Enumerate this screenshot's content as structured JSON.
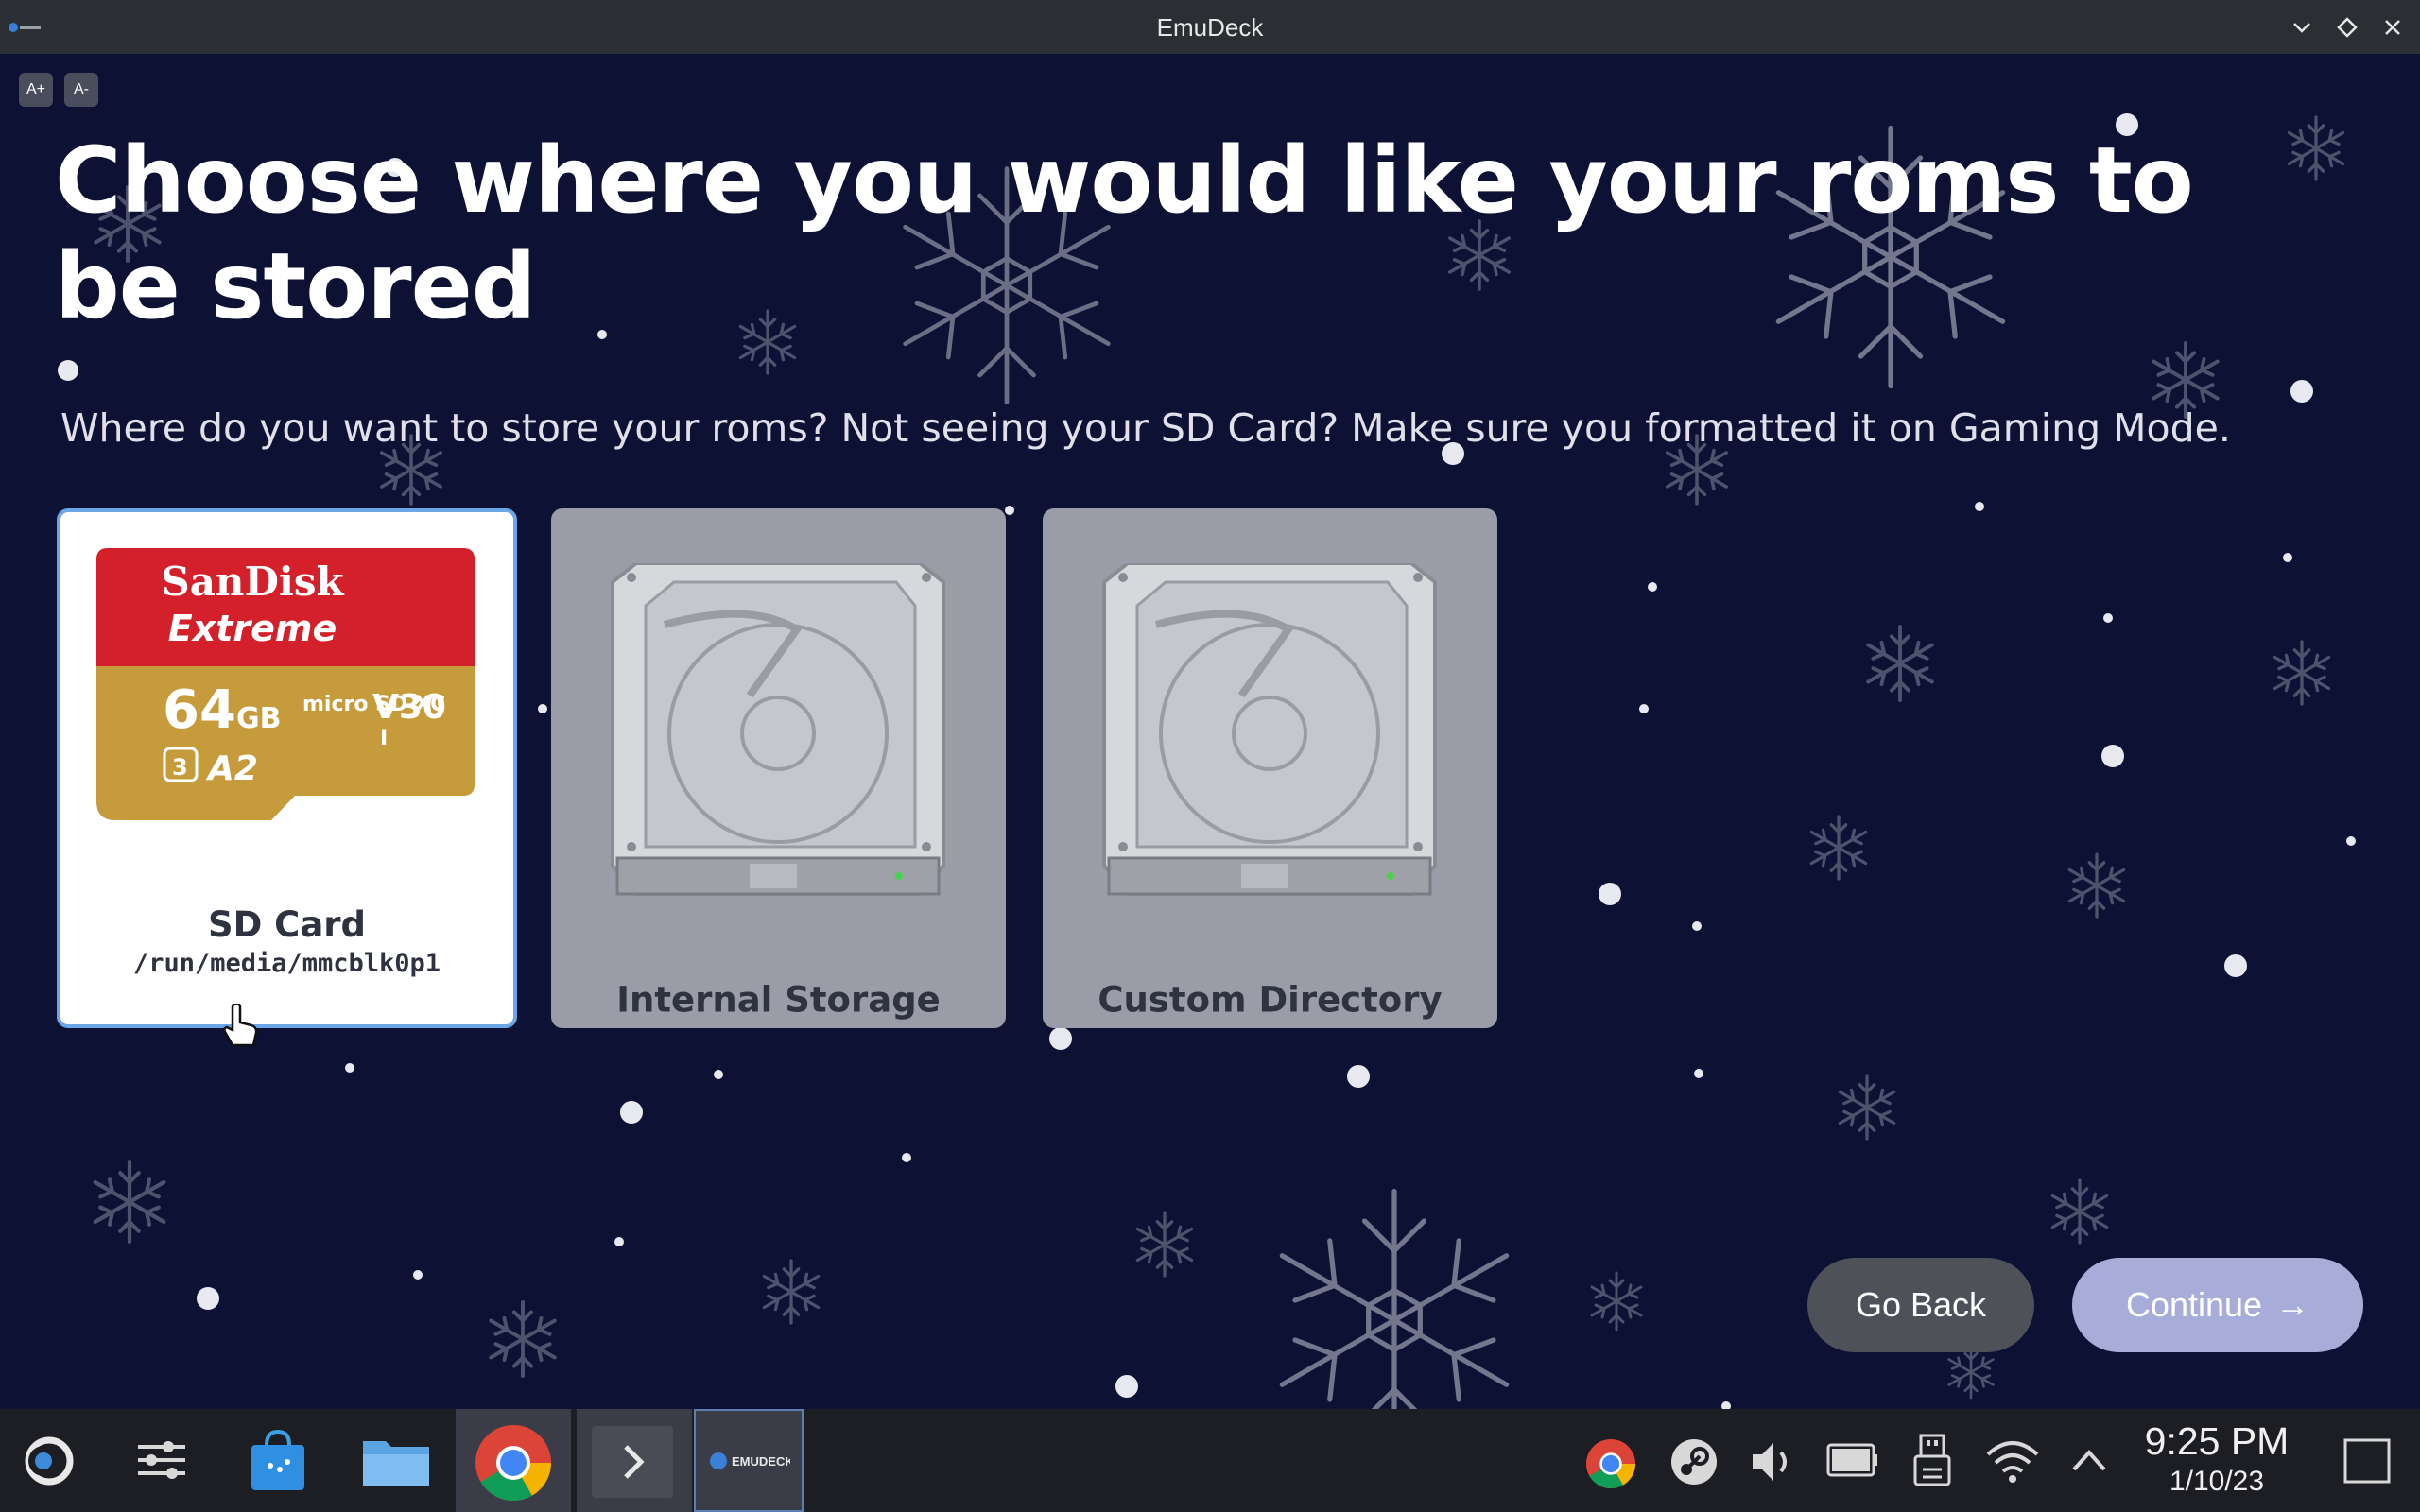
{
  "window": {
    "title": "EmuDeck"
  },
  "font_controls": {
    "increase": "A+",
    "decrease": "A-"
  },
  "page": {
    "heading": "Choose where you would like your roms to be stored",
    "subtitle": "Where do you want to store your roms? Not seeing your SD Card? Make sure you formatted it on Gaming Mode."
  },
  "storage_options": [
    {
      "label": "SD Card",
      "path": "/run/media/mmcblk0p1",
      "selected": true,
      "card_brand": "SanDisk",
      "card_line": "Extreme",
      "capacity": "64",
      "capacity_unit": "GB",
      "format": "micro SD XC",
      "speed_class": "V30",
      "app_class": "A2",
      "uhs": "3",
      "bus": "I"
    },
    {
      "label": "Internal Storage",
      "selected": false
    },
    {
      "label": "Custom Directory",
      "selected": false
    }
  ],
  "actions": {
    "back_label": "Go Back",
    "continue_label": "Continue"
  },
  "taskbar": {
    "time": "9:25 PM",
    "date": "1/10/23",
    "emudeck_label": "EMUDECK"
  },
  "colors": {
    "background": "#0d1133",
    "selected_border": "#6aa6e8",
    "continue": "#a7acd9",
    "back": "#4f5159"
  }
}
